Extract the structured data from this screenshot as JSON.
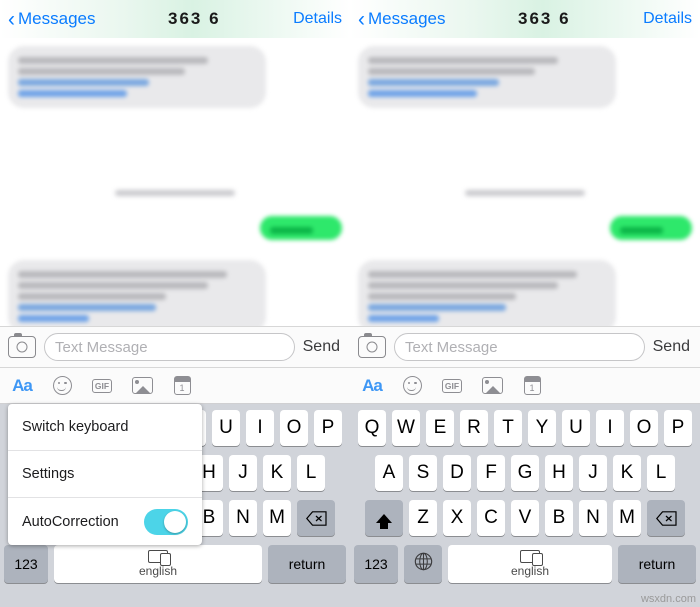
{
  "navbar": {
    "back_label": "Messages",
    "back_icon": "chevron-left-icon",
    "title": "363 6",
    "right_label": "Details"
  },
  "input_bar": {
    "camera_icon": "camera-icon",
    "placeholder": "Text Message",
    "value": "",
    "send_label": "Send"
  },
  "app_strip": {
    "items": [
      {
        "icon": "aa-text-format-icon",
        "label": "Aa"
      },
      {
        "icon": "smiley-face-icon",
        "label": ""
      },
      {
        "icon": "gif-icon",
        "label": "GIF"
      },
      {
        "icon": "photos-icon",
        "label": ""
      },
      {
        "icon": "calendar-icon",
        "label": "1"
      }
    ]
  },
  "keyboard": {
    "row1": [
      "Q",
      "W",
      "E",
      "R",
      "T",
      "Y",
      "U",
      "I",
      "O",
      "P"
    ],
    "row2": [
      "A",
      "S",
      "D",
      "F",
      "G",
      "H",
      "J",
      "K",
      "L"
    ],
    "row3": [
      "Z",
      "X",
      "C",
      "V",
      "B",
      "N",
      "M"
    ],
    "shift_icon": "shift-arrow-icon",
    "delete_icon": "backspace-icon",
    "numbers_label": "123",
    "globe_icon": "globe-icon",
    "space_label": "english",
    "space_icon": "dual-keyboard-icon",
    "return_label": "return"
  },
  "popup_menu": {
    "items": [
      {
        "label": "Switch keyboard",
        "control": "none"
      },
      {
        "label": "Settings",
        "control": "none"
      },
      {
        "label": "AutoCorrection",
        "control": "toggle",
        "toggle_on": true
      }
    ],
    "toggle_color": "#4cd4e8"
  },
  "conversation": {
    "bubbles": [
      {
        "side": "incoming",
        "blurred": true
      },
      {
        "side": "outgoing",
        "blurred": true,
        "color": "#2ee86b"
      },
      {
        "side": "incoming",
        "blurred": true
      }
    ],
    "timestamp_blurred": true
  },
  "watermark": "wsxdn.com",
  "colors": {
    "accent_blue": "#0a7cff",
    "bubble_green": "#2ee86b",
    "bubble_gray": "#e9e9eb",
    "keyboard_bg": "#d1d4da",
    "key_bg": "#ffffff",
    "key_dark_bg": "#adb3bd"
  }
}
